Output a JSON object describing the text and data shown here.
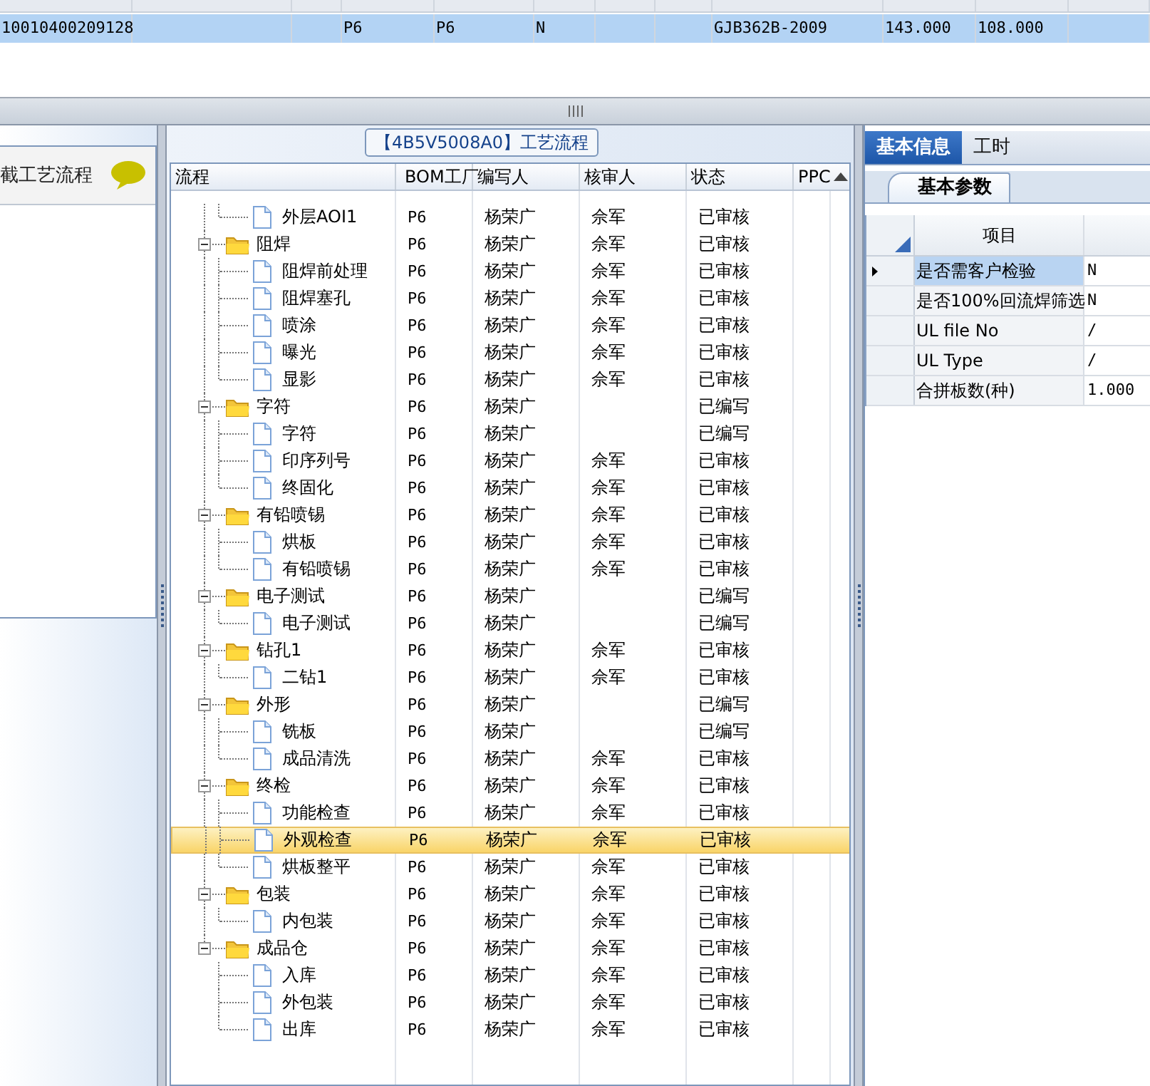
{
  "top_grid": {
    "rows": [
      {
        "selected": true,
        "cells": [
          "10010400209128",
          null,
          null,
          "P6",
          "P6",
          "N",
          null,
          null,
          "GJB362B-2009",
          "143.000",
          "108.000",
          null
        ]
      }
    ]
  },
  "left_panel": {
    "title": "截工艺流程"
  },
  "process_flow": {
    "title": "【4B5V5008A0】工艺流程",
    "columns": [
      "流程",
      "BOM工厂",
      "编写人",
      "核审人",
      "状态",
      "PPC"
    ],
    "rows": [
      {
        "kind": "folder",
        "children": [
          {
            "kind": "step",
            "name": "外层AOI1",
            "plant": "P6",
            "author": "杨荣广",
            "reviewer": "佘军",
            "status": "已审核",
            "selected": false
          }
        ]
      },
      {
        "kind": "folder",
        "name": "阻焊",
        "plant": "P6",
        "author": "杨荣广",
        "reviewer": "佘军",
        "status": "已审核",
        "expanded": true,
        "selected": false,
        "children": [
          {
            "kind": "step",
            "name": "阻焊前处理",
            "plant": "P6",
            "author": "杨荣广",
            "reviewer": "佘军",
            "status": "已审核",
            "selected": false
          },
          {
            "kind": "step",
            "name": "阻焊塞孔",
            "plant": "P6",
            "author": "杨荣广",
            "reviewer": "佘军",
            "status": "已审核",
            "selected": false
          },
          {
            "kind": "step",
            "name": "喷涂",
            "plant": "P6",
            "author": "杨荣广",
            "reviewer": "佘军",
            "status": "已审核",
            "selected": false
          },
          {
            "kind": "step",
            "name": "曝光",
            "plant": "P6",
            "author": "杨荣广",
            "reviewer": "佘军",
            "status": "已审核",
            "selected": false
          },
          {
            "kind": "step",
            "name": "显影",
            "plant": "P6",
            "author": "杨荣广",
            "reviewer": "佘军",
            "status": "已审核",
            "selected": false
          }
        ]
      },
      {
        "kind": "folder",
        "name": "字符",
        "plant": "P6",
        "author": "杨荣广",
        "status": "已编写",
        "expanded": true,
        "selected": false,
        "children": [
          {
            "kind": "step",
            "name": "字符",
            "plant": "P6",
            "author": "杨荣广",
            "status": "已编写",
            "selected": false
          },
          {
            "kind": "step",
            "name": "印序列号",
            "plant": "P6",
            "author": "杨荣广",
            "reviewer": "佘军",
            "status": "已审核",
            "selected": false
          },
          {
            "kind": "step",
            "name": "终固化",
            "plant": "P6",
            "author": "杨荣广",
            "reviewer": "佘军",
            "status": "已审核",
            "selected": false
          }
        ]
      },
      {
        "kind": "folder",
        "name": "有铅喷锡",
        "plant": "P6",
        "author": "杨荣广",
        "reviewer": "佘军",
        "status": "已审核",
        "expanded": true,
        "selected": false,
        "children": [
          {
            "kind": "step",
            "name": "烘板",
            "plant": "P6",
            "author": "杨荣广",
            "reviewer": "佘军",
            "status": "已审核",
            "selected": false
          },
          {
            "kind": "step",
            "name": "有铅喷锡",
            "plant": "P6",
            "author": "杨荣广",
            "reviewer": "佘军",
            "status": "已审核",
            "selected": false
          }
        ]
      },
      {
        "kind": "folder",
        "name": "电子测试",
        "plant": "P6",
        "author": "杨荣广",
        "status": "已编写",
        "expanded": true,
        "selected": false,
        "children": [
          {
            "kind": "step",
            "name": "电子测试",
            "plant": "P6",
            "author": "杨荣广",
            "status": "已编写",
            "selected": false
          }
        ]
      },
      {
        "kind": "folder",
        "name": "钻孔1",
        "plant": "P6",
        "author": "杨荣广",
        "reviewer": "佘军",
        "status": "已审核",
        "expanded": true,
        "selected": false,
        "children": [
          {
            "kind": "step",
            "name": "二钻1",
            "plant": "P6",
            "author": "杨荣广",
            "reviewer": "佘军",
            "status": "已审核",
            "selected": false
          }
        ]
      },
      {
        "kind": "folder",
        "name": "外形",
        "plant": "P6",
        "author": "杨荣广",
        "status": "已编写",
        "expanded": true,
        "selected": false,
        "children": [
          {
            "kind": "step",
            "name": "铣板",
            "plant": "P6",
            "author": "杨荣广",
            "status": "已编写",
            "selected": false
          },
          {
            "kind": "step",
            "name": "成品清洗",
            "plant": "P6",
            "author": "杨荣广",
            "reviewer": "佘军",
            "status": "已审核",
            "selected": false
          }
        ]
      },
      {
        "kind": "folder",
        "name": "终检",
        "plant": "P6",
        "author": "杨荣广",
        "reviewer": "佘军",
        "status": "已审核",
        "expanded": true,
        "selected": false,
        "children": [
          {
            "kind": "step",
            "name": "功能检查",
            "plant": "P6",
            "author": "杨荣广",
            "reviewer": "佘军",
            "status": "已审核",
            "selected": false
          },
          {
            "kind": "step",
            "name": "外观检查",
            "plant": "P6",
            "author": "杨荣广",
            "reviewer": "佘军",
            "status": "已审核",
            "selected": true
          },
          {
            "kind": "step",
            "name": "烘板整平",
            "plant": "P6",
            "author": "杨荣广",
            "reviewer": "佘军",
            "status": "已审核",
            "selected": false
          }
        ]
      },
      {
        "kind": "folder",
        "name": "包装",
        "plant": "P6",
        "author": "杨荣广",
        "reviewer": "佘军",
        "status": "已审核",
        "expanded": true,
        "selected": false,
        "children": [
          {
            "kind": "step",
            "name": "内包装",
            "plant": "P6",
            "author": "杨荣广",
            "reviewer": "佘军",
            "status": "已审核",
            "selected": false
          }
        ]
      },
      {
        "kind": "folder",
        "name": "成品仓",
        "plant": "P6",
        "author": "杨荣广",
        "reviewer": "佘军",
        "status": "已审核",
        "expanded": true,
        "selected": false,
        "children": [
          {
            "kind": "step",
            "name": "入库",
            "plant": "P6",
            "author": "杨荣广",
            "reviewer": "佘军",
            "status": "已审核",
            "selected": false
          },
          {
            "kind": "step",
            "name": "外包装",
            "plant": "P6",
            "author": "杨荣广",
            "reviewer": "佘军",
            "status": "已审核",
            "selected": false
          },
          {
            "kind": "step",
            "name": "出库",
            "plant": "P6",
            "author": "杨荣广",
            "reviewer": "佘军",
            "status": "已审核",
            "selected": false
          }
        ]
      }
    ]
  },
  "info_panel": {
    "tabs": [
      {
        "label": "基本信息",
        "selected": true
      },
      {
        "label": "工时",
        "selected": false
      }
    ],
    "subtabs": [
      {
        "label": "基本参数",
        "selected": true
      }
    ],
    "columns": [
      "项目"
    ],
    "rows": [
      {
        "item": "是否需客户检验",
        "value": "N",
        "selected": true
      },
      {
        "item": "是否100%回流焊筛选",
        "value": "N",
        "selected": false
      },
      {
        "item": "UL file No",
        "value": "/",
        "selected": false
      },
      {
        "item": "UL Type",
        "value": "/",
        "selected": false
      },
      {
        "item": "合拼板数(种)",
        "value": "1.000",
        "selected": false
      }
    ]
  }
}
